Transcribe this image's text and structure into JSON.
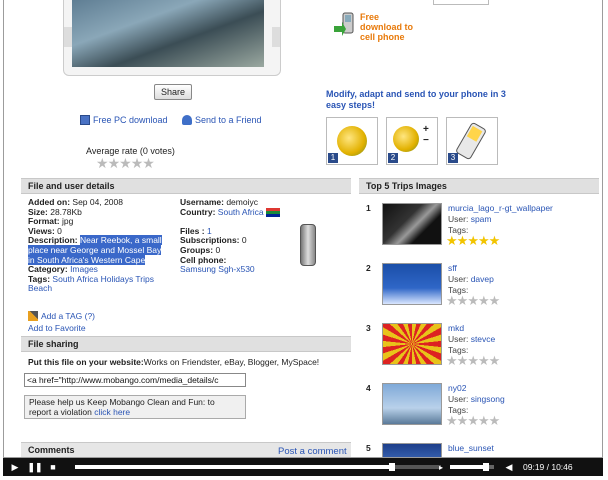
{
  "preview": {
    "share_label": "Share"
  },
  "links": {
    "free_pc": "Free PC download",
    "send_friend": "Send to a Friend"
  },
  "rating": {
    "label": "Average rate (0 votes)",
    "value": 0,
    "max": 5
  },
  "download_phone": {
    "line1": "Free",
    "line2": "download to",
    "line3": "cell phone"
  },
  "modify_text": "Modify, adapt and send to your phone in 3 easy steps!",
  "steps": [
    "1",
    "2",
    "3"
  ],
  "sections": {
    "file_details": "File and user details",
    "top5": "Top 5 Trips Images",
    "file_sharing": "File sharing",
    "comments": "Comments"
  },
  "details": {
    "added_on_label": "Added on:",
    "added_on": "Sep 04, 2008",
    "size_label": "Size:",
    "size": "28.78Kb",
    "format_label": "Format:",
    "format": "jpg",
    "views_label": "Views:",
    "views": "0",
    "description_label": "Description:",
    "description_l1": "Near Reebok, a small",
    "description_l2": "place near George and Mossel Bay",
    "description_l3": "in South Africa's Western Cape",
    "category_label": "Category:",
    "category": "Images",
    "tags_label": "Tags:",
    "tags_l1": "South Africa Holidays Trips",
    "tags_l2": "Beach",
    "add_tag": "Add a TAG (?)",
    "add_favorite": "Add to Favorite"
  },
  "user": {
    "username_label": "Username:",
    "username": "demoiyc",
    "country_label": "Country:",
    "country": "South Africa",
    "files_label": "Files :",
    "files": "1",
    "subscriptions_label": "Subscriptions:",
    "subscriptions": "0",
    "groups_label": "Groups:",
    "groups": "0",
    "cell_phone_label": "Cell phone:",
    "cell_phone": "Samsung Sgh-x530"
  },
  "sharing": {
    "put_label": "Put this file on your website:",
    "put_text": "Works on Friendster, eBay, Blogger, MySpace!",
    "embed_value": "<a href=\"http://www.mobango.com/media_details/c",
    "report_l1": "Please help us Keep Mobango Clean and Fun: to",
    "report_l2": "report a violation ",
    "report_link": "click here"
  },
  "post_comment": "Post a comment",
  "trips": [
    {
      "n": "1",
      "title": "murcia_lago_r-gt_wallpaper",
      "user_label": "User:",
      "user": "spam",
      "tags_label": "Tags:",
      "rating": 5
    },
    {
      "n": "2",
      "title": "sff",
      "user_label": "User:",
      "user": "davep",
      "tags_label": "Tags:",
      "rating": 0
    },
    {
      "n": "3",
      "title": "mkd",
      "user_label": "User:",
      "user": "stevce",
      "tags_label": "Tags:",
      "rating": 0
    },
    {
      "n": "4",
      "title": "ny02",
      "user_label": "User:",
      "user": "singsong",
      "tags_label": "Tags:",
      "rating": 0
    },
    {
      "n": "5",
      "title": "blue_sunset",
      "user_label": "",
      "user": "",
      "tags_label": "",
      "rating": 0
    }
  ],
  "player": {
    "time": "09:19 / 10:46",
    "progress": 0.865,
    "volume": 0.82
  }
}
